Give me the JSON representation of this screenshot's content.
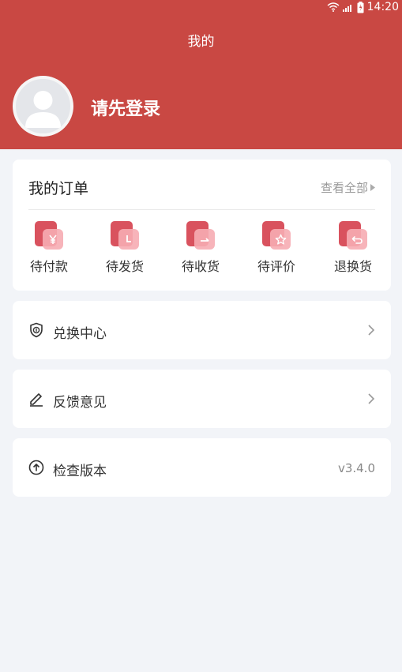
{
  "status_bar": {
    "time": "14:20"
  },
  "header": {
    "title": "我的",
    "login_prompt": "请先登录"
  },
  "orders": {
    "title": "我的订单",
    "view_all": "查看全部",
    "items": [
      {
        "label": "待付款",
        "icon": "yen-icon"
      },
      {
        "label": "待发货",
        "icon": "clock-icon"
      },
      {
        "label": "待收货",
        "icon": "receive-icon"
      },
      {
        "label": "待评价",
        "icon": "star-icon"
      },
      {
        "label": "退换货",
        "icon": "return-icon"
      }
    ]
  },
  "menu": {
    "exchange": {
      "label": "兑换中心",
      "icon": "shield-coin-icon"
    },
    "feedback": {
      "label": "反馈意见",
      "icon": "pencil-icon"
    },
    "update": {
      "label": "检查版本",
      "icon": "arrow-up-circle-icon",
      "version": "v3.4.0"
    }
  },
  "colors": {
    "brand": "#c94843",
    "icon_accent": "#d9525e",
    "background": "#f2f4f8"
  }
}
